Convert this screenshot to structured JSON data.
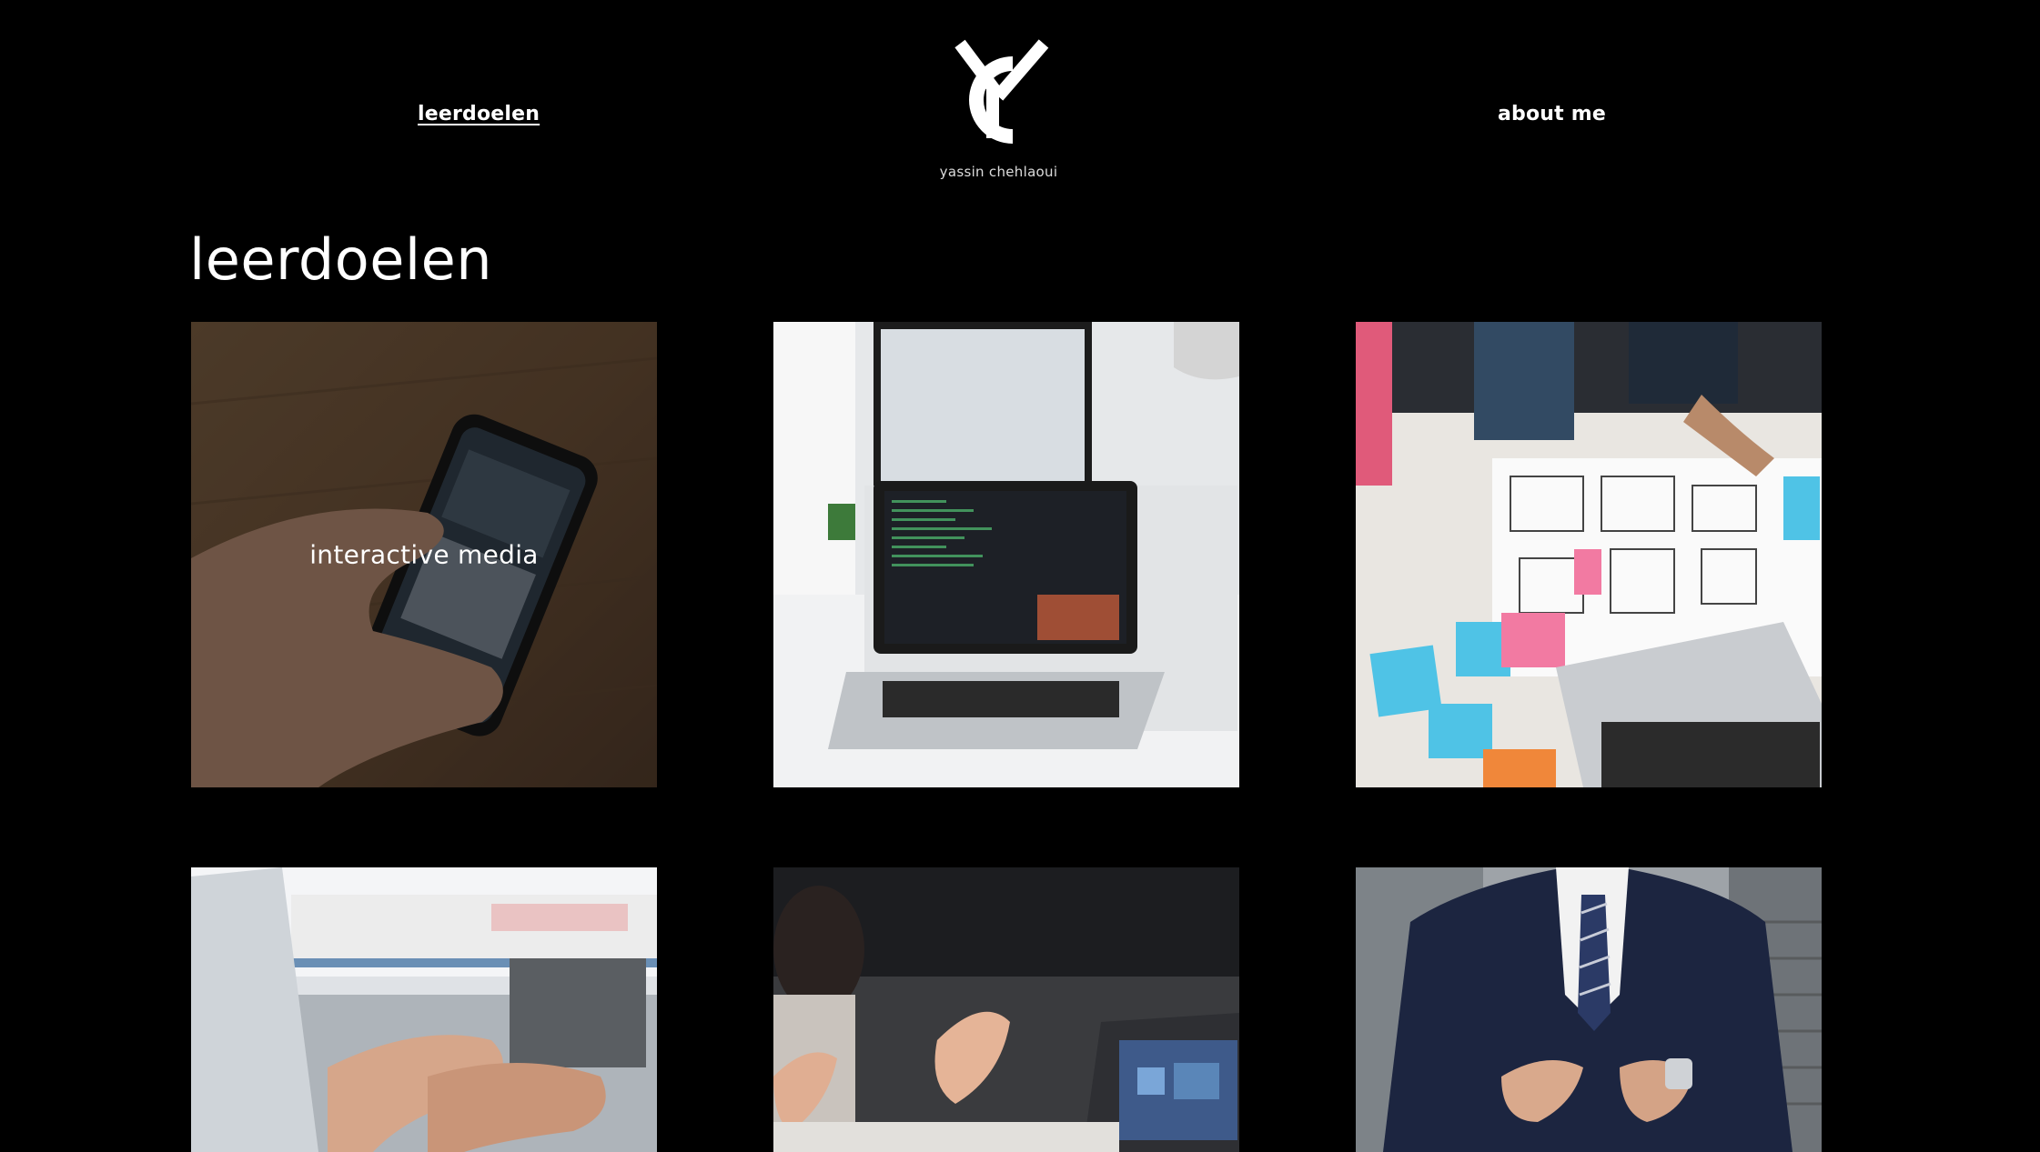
{
  "nav": {
    "left_label": "leerdoelen",
    "right_label": "about me"
  },
  "logo": {
    "name": "yassin chehlaoui"
  },
  "page": {
    "title": "leerdoelen"
  },
  "tiles": [
    {
      "caption": "interactive media",
      "image": "hand holding smartphone on wooden table"
    },
    {
      "caption": "",
      "image": "laptop with code editor on white desk"
    },
    {
      "caption": "",
      "image": "team sketching wireframes with sticky notes"
    },
    {
      "caption": "",
      "image": "hands typing on laptop keyboard"
    },
    {
      "caption": "",
      "image": "person gesturing during meeting near laptop"
    },
    {
      "caption": "",
      "image": "man in dark suit adjusting jacket"
    }
  ]
}
